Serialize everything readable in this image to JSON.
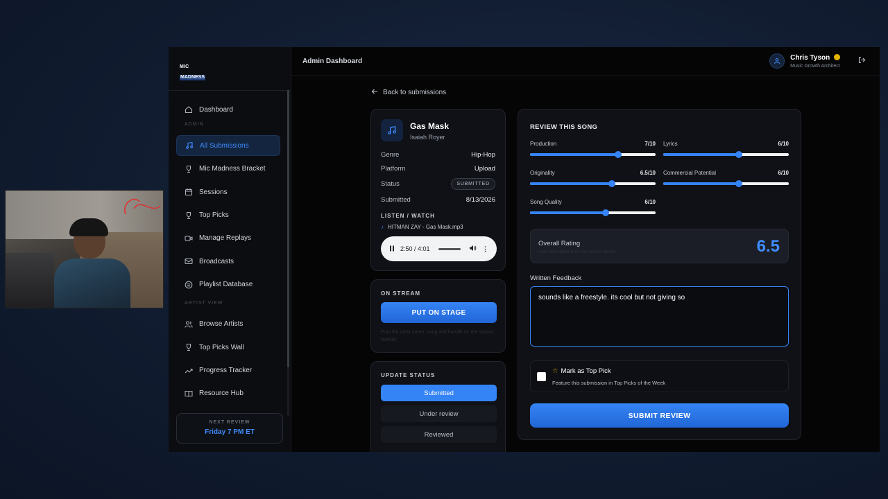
{
  "app": {
    "logo_line1": "MIC",
    "logo_line2": "MADNESS",
    "header_title": "Admin Dashboard"
  },
  "user": {
    "name": "Chris Tyson",
    "role": "Music Growth Architect"
  },
  "sidebar": {
    "dashboard": "Dashboard",
    "section_admin": "ADMIN",
    "admin_items": [
      {
        "label": "All Submissions",
        "icon": "music-note-icon",
        "active": true
      },
      {
        "label": "Mic Madness Bracket",
        "icon": "trophy-icon"
      },
      {
        "label": "Sessions",
        "icon": "calendar-icon"
      },
      {
        "label": "Top Picks",
        "icon": "trophy-icon"
      },
      {
        "label": "Manage Replays",
        "icon": "video-icon"
      },
      {
        "label": "Broadcasts",
        "icon": "mail-icon"
      },
      {
        "label": "Playlist Database",
        "icon": "spotify-icon"
      }
    ],
    "section_artist": "ARTIST VIEW",
    "artist_items": [
      {
        "label": "Browse Artists",
        "icon": "users-icon"
      },
      {
        "label": "Top Picks Wall",
        "icon": "trophy-icon"
      },
      {
        "label": "Progress Tracker",
        "icon": "trend-icon"
      },
      {
        "label": "Resource Hub",
        "icon": "book-icon"
      }
    ],
    "next_review_title": "NEXT REVIEW",
    "next_review_value": "Friday 7 PM ET"
  },
  "back_link": "Back to submissions",
  "song": {
    "title": "Gas Mask",
    "artist": "Isaiah Royer",
    "genre_label": "Genre",
    "genre": "Hip-Hop",
    "platform_label": "Platform",
    "platform": "Upload",
    "status_label": "Status",
    "status": "SUBMITTED",
    "submitted_label": "Submitted",
    "submitted": "8/13/2026",
    "listen_label": "LISTEN / WATCH",
    "file": "HITMAN ZAY - Gas Mask.mp3",
    "player_time": "2:50 / 4:01"
  },
  "stream": {
    "label": "ON STREAM",
    "button": "PUT ON STAGE",
    "hint": "Puts the artist name, song and handle on the stream overlay"
  },
  "update_status": {
    "label": "UPDATE STATUS",
    "options": [
      "Submitted",
      "Under review",
      "Reviewed"
    ],
    "selected": "Submitted"
  },
  "review": {
    "title": "REVIEW THIS SONG",
    "scores": [
      {
        "label": "Production",
        "value": "7/10",
        "score": 7
      },
      {
        "label": "Lyrics",
        "value": "6/10",
        "score": 6
      },
      {
        "label": "Originality",
        "value": "6.5/10",
        "score": 6.5
      },
      {
        "label": "Commercial Potential",
        "value": "6/10",
        "score": 6
      },
      {
        "label": "Song Quality",
        "value": "6/10",
        "score": 6
      }
    ],
    "overall_label": "Overall Rating",
    "overall_sub": "Auto-calculated from the scores above",
    "overall_value": "6.5",
    "feedback_label": "Written Feedback",
    "feedback_value": "sounds like a freestyle. its cool but not giving so",
    "top_pick_label": "Mark as Top Pick",
    "top_pick_desc": "Feature this submission in Top Picks of the Week",
    "submit_label": "SUBMIT REVIEW"
  },
  "colors": {
    "accent": "#3584f5",
    "background": "#050506",
    "gold": "#e6b400"
  }
}
